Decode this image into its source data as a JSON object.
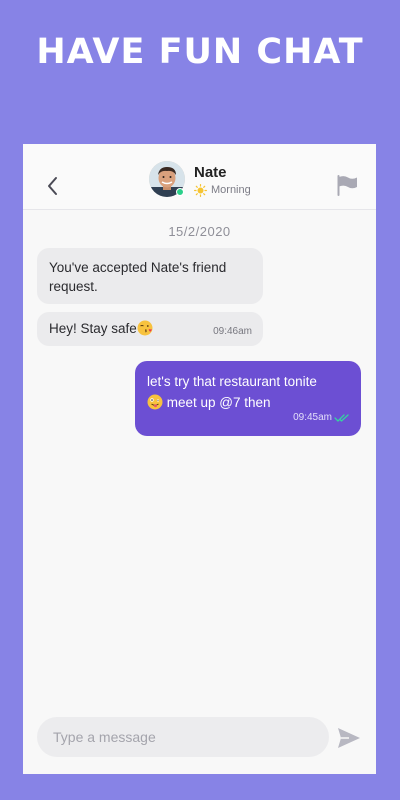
{
  "promo": {
    "headline": "HAVE FUN CHAT"
  },
  "chat_header": {
    "contact_name": "Nate",
    "status_text": "Morning",
    "icons": {
      "back": "chevron-left-icon",
      "status": "sun-icon",
      "report": "flag-icon"
    }
  },
  "conversation": {
    "date_separator": "15/2/2020",
    "messages": [
      {
        "direction": "incoming",
        "text": "You've accepted Nate's friend request.",
        "time": ""
      },
      {
        "direction": "incoming",
        "text": "Hey! Stay safe",
        "emoji": "kissing-face-emoji",
        "time": "09:46am"
      },
      {
        "direction": "outgoing",
        "text_line1": "let's try that restaurant tonite",
        "text_line2": "meet up @7 then",
        "emoji": "zany-face-emoji",
        "time": "09:45am",
        "read_status": "double-check-icon"
      }
    ]
  },
  "composer": {
    "placeholder": "Type a message",
    "value": "",
    "send_icon": "send-icon"
  },
  "colors": {
    "background": "#8783e6",
    "outgoing_bubble": "#6c4fd3",
    "incoming_bubble": "#ebebed",
    "online": "#2bd08a",
    "read_check": "#36d1a0",
    "sun": "#f6c431"
  }
}
